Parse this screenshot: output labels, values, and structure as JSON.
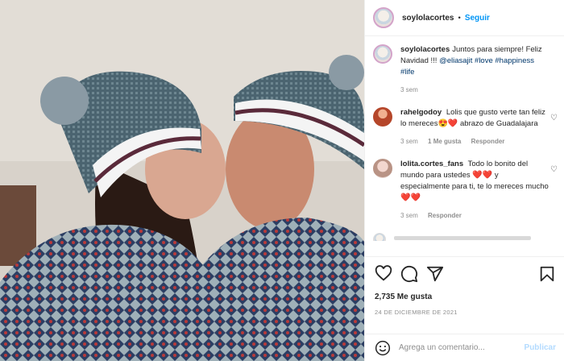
{
  "header": {
    "username": "soylolacortes",
    "separator": "•",
    "follow": "Seguir",
    "more": "•••"
  },
  "caption": {
    "username": "soylolacortes",
    "text": "Juntos para siempre! Feliz Navidad !!! ",
    "mention": "@eliasajit",
    "tags": " #love #happiness #life",
    "time": "3 sem"
  },
  "comments": [
    {
      "username": "rahelgodoy",
      "text": "Lolis que gusto verte tan feliz lo mereces",
      "emoji": "😍❤️",
      "text2": "abrazo de Guadalajara",
      "time": "3 sem",
      "likes": "1 Me gusta",
      "reply": "Responder"
    },
    {
      "username": "lolita.cortes_fans",
      "text": "Todo lo bonito del mundo para ustedes",
      "emoji": "❤️❤️",
      "text2": "y especialmente para ti, te lo mereces mucho",
      "emoji2": "❤️❤️",
      "time": "3 sem",
      "reply": "Responder"
    }
  ],
  "actions": {
    "likes": "2,735 Me gusta",
    "date": "24 DE DICIEMBRE DE 2021"
  },
  "add_comment": {
    "placeholder": "Agrega un comentario...",
    "publish": "Publicar"
  },
  "icons": [
    "heart-icon",
    "comment-icon",
    "share-icon",
    "bookmark-icon",
    "emoji-icon",
    "more-icon"
  ]
}
